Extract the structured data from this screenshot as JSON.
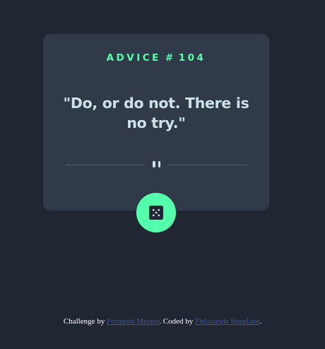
{
  "card": {
    "advice_label": "ADVICE",
    "advice_separator": "#",
    "advice_id": "104",
    "quote": "\"Do, or do not. There is no try.\""
  },
  "divider": {
    "icon": "pause-icon"
  },
  "dice_button": {
    "icon": "dice-icon"
  },
  "attribution": {
    "prefix": "Challenge by",
    "challenge_link": "Frontend Mentor",
    "middle": ". Coded by",
    "author_link": "Philasande Simelane",
    "suffix": "."
  },
  "colors": {
    "background": "#202733",
    "card": "#313A49",
    "accent": "#53FFAA",
    "text": "#CEE3E9",
    "divider": "#4F5D74",
    "link": "#3E52A3"
  }
}
